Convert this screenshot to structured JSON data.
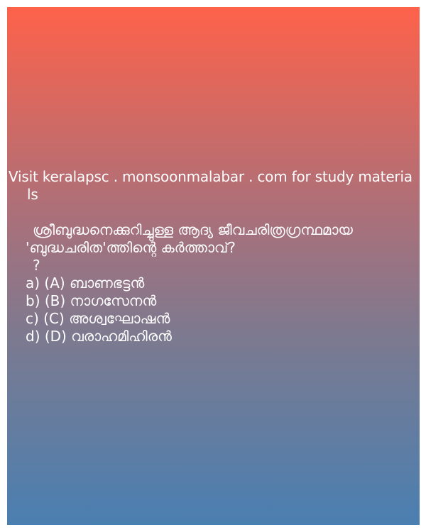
{
  "promo": {
    "line1": "Visit keralapsc . monsoonmalabar . com for study materia",
    "line2": "ls"
  },
  "question": {
    "line1": "ശ്രീബുദ്ധനെക്കുറിച്ചുള്ള ആദ്യ ജീവചരിത്രഗ്രന്ഥമായ",
    "line2": "'ബുദ്ധചരിത'ത്തിന്റെ കർത്താവ്?",
    "line3": "?"
  },
  "options": [
    {
      "text": "a) (A) ബാണഭട്ടൻ"
    },
    {
      "text": "b) (B) നാഗസേനൻ"
    },
    {
      "text": "c) (C) അശ്വഘോഷൻ"
    },
    {
      "text": "d) (D) വരാഹമിഹിരൻ"
    }
  ],
  "colors": {
    "gradient_top": "#fe624a",
    "gradient_bottom": "#4a7fb1",
    "text": "#ffffff"
  }
}
